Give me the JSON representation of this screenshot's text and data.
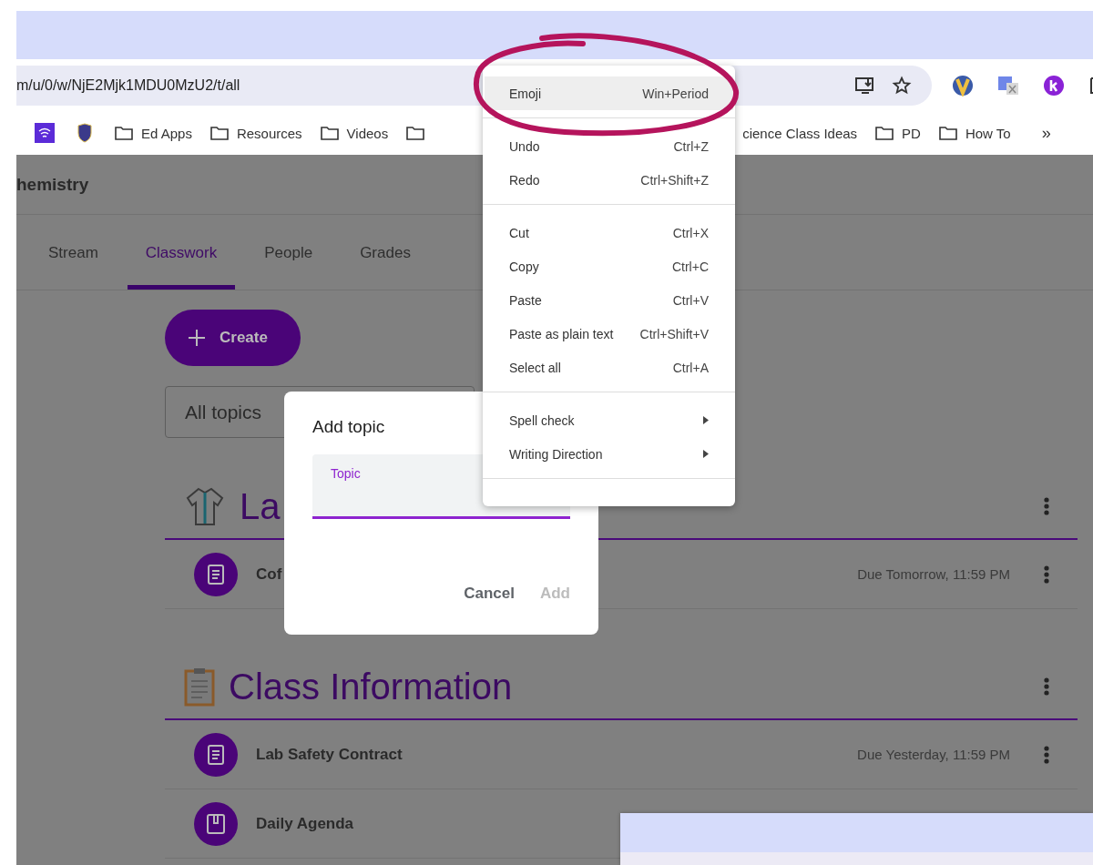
{
  "browser": {
    "url": "m/u/0/w/NjE2Mjk1MDU0MzU2/t/all",
    "bookmarks": [
      {
        "kind": "wifi"
      },
      {
        "kind": "shield"
      },
      {
        "kind": "folder",
        "label": "Ed Apps"
      },
      {
        "kind": "folder",
        "label": "Resources"
      },
      {
        "kind": "folder",
        "label": "Videos"
      },
      {
        "kind": "covered",
        "label": "cience Class Ideas"
      },
      {
        "kind": "folder",
        "label": "PD"
      },
      {
        "kind": "folder",
        "label": "How To"
      }
    ],
    "overflow": "»"
  },
  "classroom": {
    "class_title": "hemistry",
    "tabs": [
      {
        "label": "Stream",
        "selected": false
      },
      {
        "label": "Classwork",
        "selected": true
      },
      {
        "label": "People",
        "selected": false
      },
      {
        "label": "Grades",
        "selected": false
      }
    ],
    "create_button": "Create",
    "topic_filter": "All topics",
    "topics": [
      {
        "title": "La",
        "kind": "lab-coat",
        "items": [
          {
            "kind": "assignment",
            "title": "Cof",
            "due": "Due Tomorrow, 11:59 PM"
          }
        ]
      },
      {
        "title": "Class Information",
        "kind": "clipboard",
        "items": [
          {
            "kind": "assignment",
            "title": "Lab Safety Contract",
            "due": "Due Yesterday, 11:59 PM"
          },
          {
            "kind": "material",
            "title": "Daily Agenda"
          }
        ]
      }
    ]
  },
  "dialog": {
    "title": "Add topic",
    "field_label": "Topic",
    "buttons": [
      {
        "label": "Cancel",
        "disabled": false
      },
      {
        "label": "Add",
        "disabled": true
      }
    ]
  },
  "context_menu": {
    "groups": [
      [
        {
          "label": "Emoji",
          "shortcut": "Win+Period",
          "highlighted": true
        }
      ],
      [
        {
          "label": "Undo",
          "shortcut": "Ctrl+Z",
          "highlighted": false
        },
        {
          "label": "Redo",
          "shortcut": "Ctrl+Shift+Z",
          "highlighted": false
        }
      ],
      [
        {
          "label": "Cut",
          "shortcut": "Ctrl+X",
          "highlighted": false
        },
        {
          "label": "Copy",
          "shortcut": "Ctrl+C",
          "highlighted": false
        },
        {
          "label": "Paste",
          "shortcut": "Ctrl+V",
          "highlighted": false
        },
        {
          "label": "Paste as plain text",
          "shortcut": "Ctrl+Shift+V",
          "highlighted": false
        },
        {
          "label": "Select all",
          "shortcut": "Ctrl+A",
          "highlighted": false
        }
      ],
      [
        {
          "label": "Spell check",
          "submenu": true,
          "highlighted": false
        },
        {
          "label": "Writing Direction",
          "submenu": true,
          "highlighted": false
        }
      ]
    ]
  }
}
